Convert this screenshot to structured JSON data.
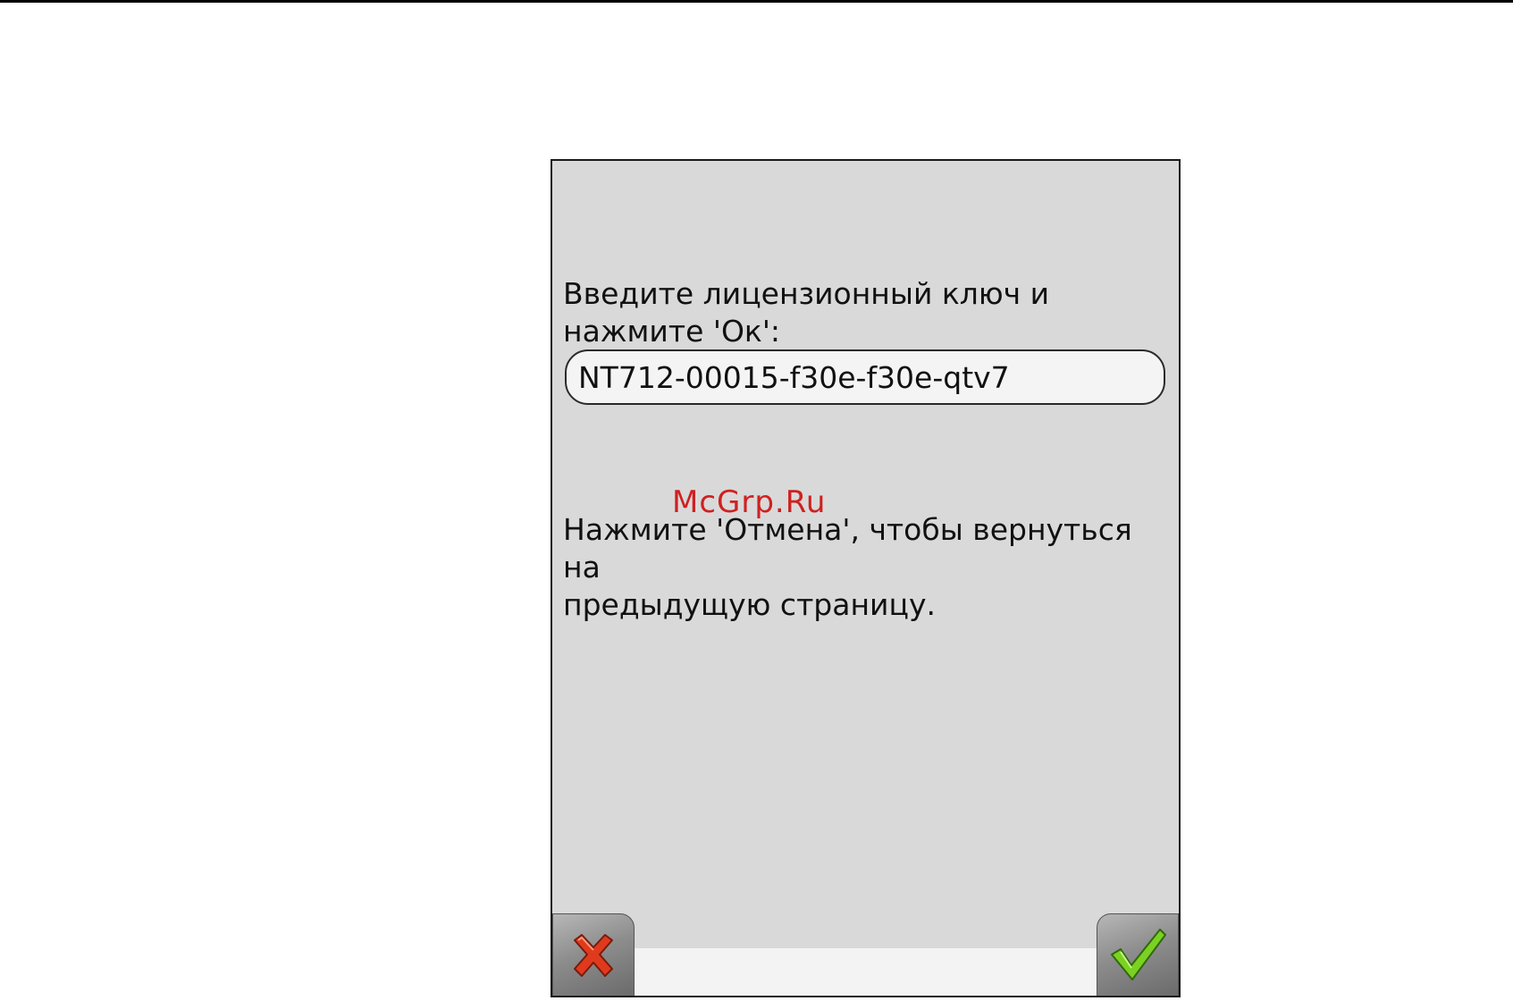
{
  "dialog": {
    "prompt": "Введите лицензионный ключ и\nнажмите 'Ок':",
    "license_key_value": "NT712-00015-f30e-f30e-qtv7",
    "cancel_hint": "Нажмите 'Отмена', чтобы вернуться на\nпредыдущую страницу."
  },
  "watermark": {
    "text": "McGrp.Ru"
  },
  "buttons": {
    "cancel_icon": "red-x-icon",
    "ok_icon": "green-checkmark-icon"
  },
  "colors": {
    "screen_background": "#d9d9d9",
    "cancel_icon": "#e03a1e",
    "ok_icon": "#7bd121",
    "watermark": "#d02020"
  }
}
